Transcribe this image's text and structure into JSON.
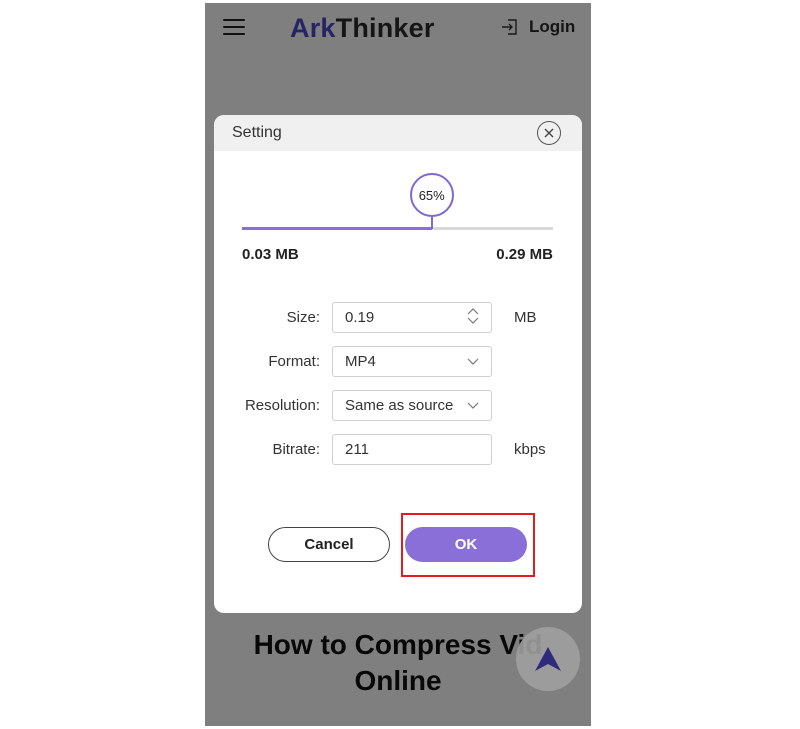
{
  "header": {
    "logo_ark": "Ark",
    "logo_thinker": "Thinker",
    "login_label": "Login"
  },
  "page": {
    "headline_line1": "How to Compress Vid",
    "headline_line2": "Online"
  },
  "dialog": {
    "title": "Setting",
    "slider": {
      "percent_label": "65%",
      "value_fraction": 0.61,
      "min_label": "0.03 MB",
      "max_label": "0.29 MB"
    },
    "fields": {
      "size_label": "Size:",
      "size_value": "0.19",
      "size_unit": "MB",
      "format_label": "Format:",
      "format_value": "MP4",
      "resolution_label": "Resolution:",
      "resolution_value": "Same as source",
      "bitrate_label": "Bitrate:",
      "bitrate_value": "211",
      "bitrate_unit": "kbps"
    },
    "buttons": {
      "cancel_label": "Cancel",
      "ok_label": "OK"
    }
  },
  "colors": {
    "accent": "#8a6fd8",
    "highlight_box": "#e01e1e"
  },
  "icons": [
    "menu-icon",
    "login-icon",
    "close-icon",
    "stepper-icon",
    "chevron-down-icon",
    "arrow-up-icon"
  ]
}
